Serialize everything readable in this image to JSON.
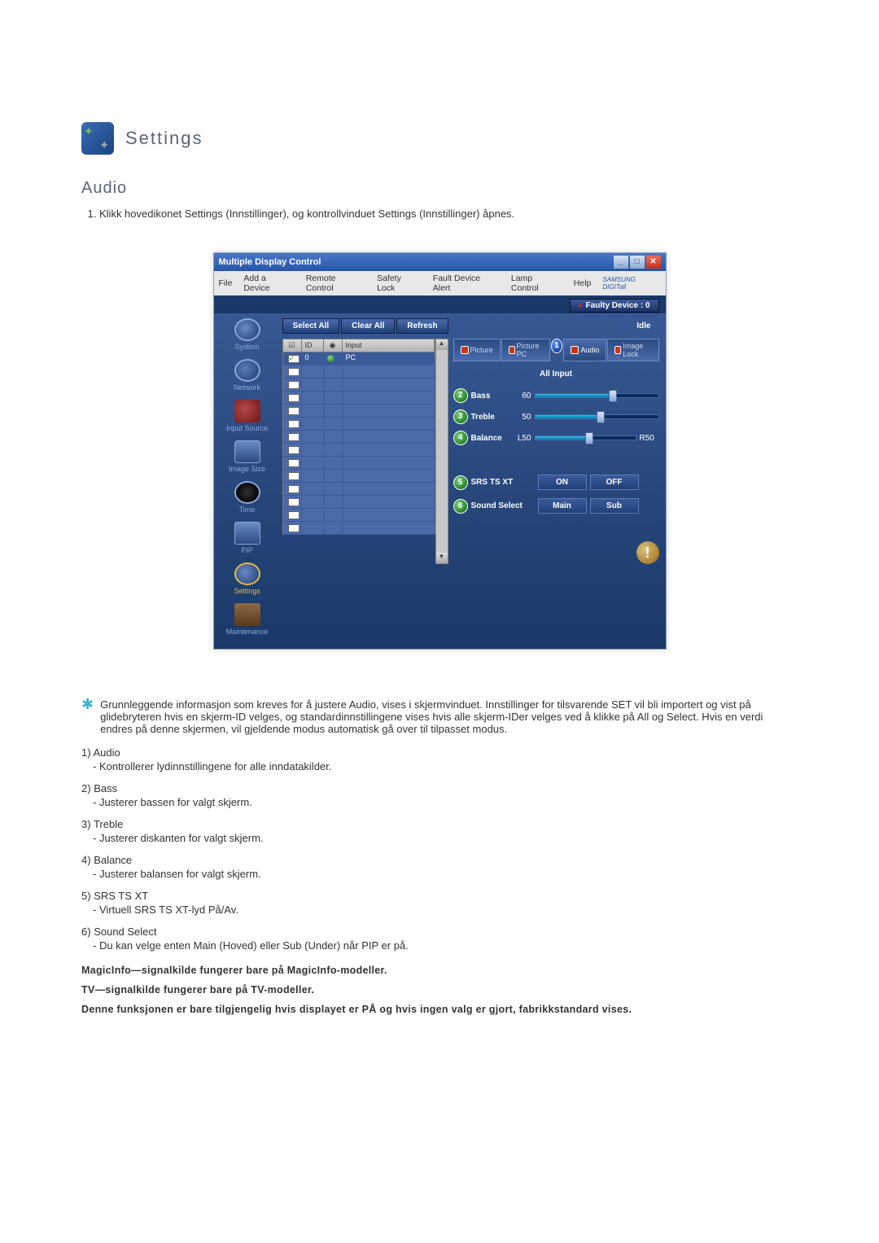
{
  "heading": "Settings",
  "section_title": "Audio",
  "intro_step": "Klikk hovedikonet Settings (Innstillinger), og kontrollvinduet Settings (Innstillinger) åpnes.",
  "screenshot": {
    "window_title": "Multiple Display Control",
    "menus": [
      "File",
      "Add a Device",
      "Remote Control",
      "Safety Lock",
      "Fault Device Alert",
      "Lamp Control",
      "Help"
    ],
    "brand": "SAMSUNG DIGITall",
    "faulty_label": "Faulty Device : 0",
    "sidebar": {
      "items": [
        {
          "label": "System"
        },
        {
          "label": "Network"
        },
        {
          "label": "Input Source"
        },
        {
          "label": "Image Size"
        },
        {
          "label": "Time"
        },
        {
          "label": "PIP"
        },
        {
          "label": "Settings"
        },
        {
          "label": "Maintenance"
        }
      ]
    },
    "toolbar": {
      "select_all": "Select All",
      "clear_all": "Clear All",
      "refresh": "Refresh",
      "idle": "Idle"
    },
    "table": {
      "hdr_id": "ID",
      "hdr_input": "Input",
      "row0_id": "0",
      "row0_input": "PC"
    },
    "tabs": {
      "picture": "Picture",
      "picture_pc": "Picture PC",
      "audio": "Audio",
      "image_lock": "Image Lock",
      "callout": "1"
    },
    "all_input": "All Input",
    "sliders": {
      "bass": {
        "label": "Bass",
        "value": "60",
        "callout": "2"
      },
      "treble": {
        "label": "Treble",
        "value": "50",
        "callout": "3"
      },
      "balance": {
        "label": "Balance",
        "left": "L50",
        "right": "R50",
        "callout": "4"
      }
    },
    "toggles": {
      "srs": {
        "label": "SRS TS XT",
        "on": "ON",
        "off": "OFF",
        "callout": "5"
      },
      "sound": {
        "label": "Sound Select",
        "main": "Main",
        "sub": "Sub",
        "callout": "6"
      }
    }
  },
  "star_text": "Grunnleggende informasjon som kreves for å justere Audio, vises i skjermvinduet. Innstillinger for tilsvarende SET vil bli importert og vist på glidebryteren hvis en skjerm-ID velges, og standardinnstillingene vises hvis alle skjerm-IDer velges ved å klikke på All og Select. Hvis en verdi endres på denne skjermen, vil gjeldende modus automatisk gå over til tilpasset modus.",
  "items": [
    {
      "n": "1)",
      "title": "Audio",
      "desc": "- Kontrollerer lydinnstillingene for alle inndatakilder."
    },
    {
      "n": "2)",
      "title": "Bass",
      "desc": "- Justerer bassen for valgt skjerm."
    },
    {
      "n": "3)",
      "title": "Treble",
      "desc": "- Justerer diskanten for valgt skjerm."
    },
    {
      "n": "4)",
      "title": "Balance",
      "desc": "- Justerer balansen for valgt skjerm."
    },
    {
      "n": "5)",
      "title": "SRS TS XT",
      "desc": "- Virtuell SRS TS XT-lyd På/Av."
    },
    {
      "n": "6)",
      "title": "Sound Select",
      "desc": "- Du kan velge enten Main (Hoved) eller Sub (Under) når PIP er på."
    }
  ],
  "notes": {
    "n1": "MagicInfo—signalkilde fungerer bare på MagicInfo-modeller.",
    "n2": "TV—signalkilde fungerer bare på TV-modeller.",
    "n3": "Denne funksjonen er bare tilgjengelig hvis displayet er PÅ og hvis ingen valg er gjort, fabrikkstandard vises."
  }
}
